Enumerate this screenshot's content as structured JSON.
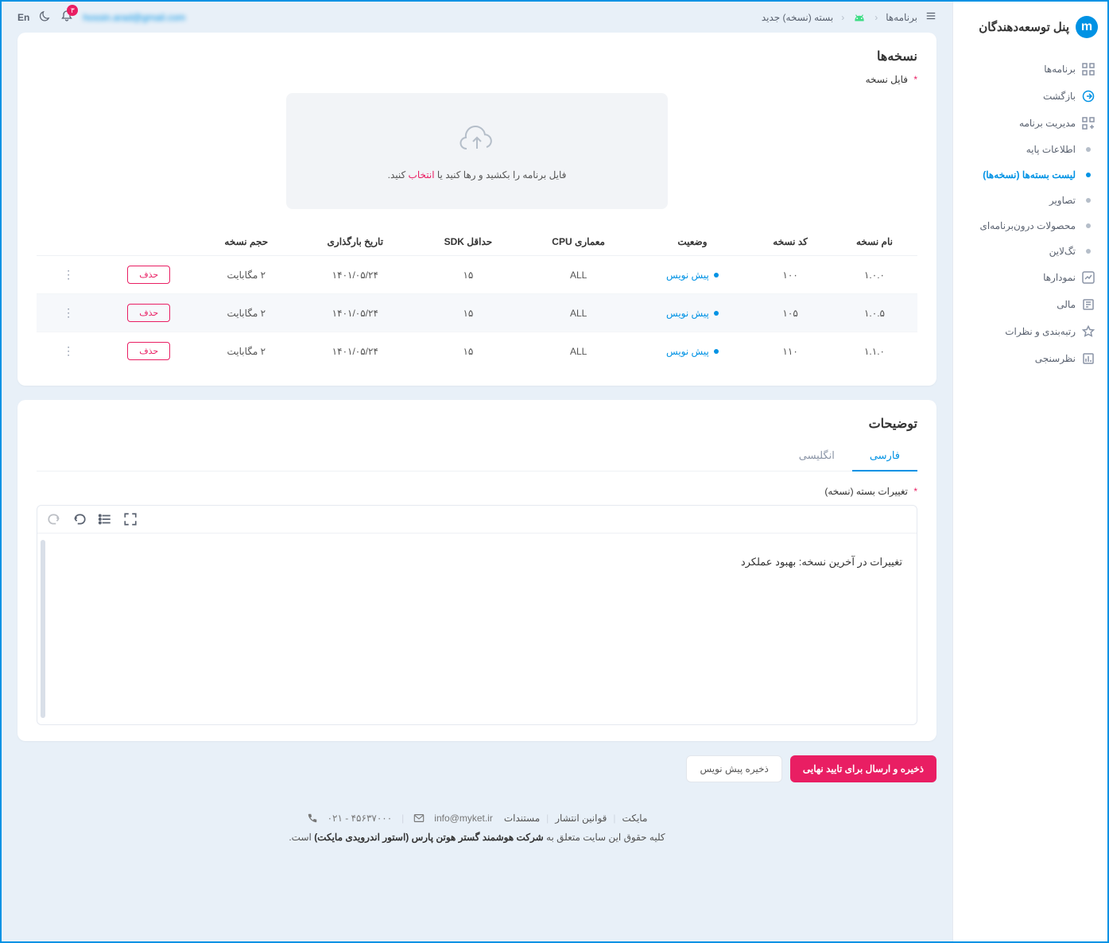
{
  "brand": {
    "title": "پنل توسعه‌دهندگان"
  },
  "nav": {
    "apps": "برنامه‌ها",
    "back": "بازگشت",
    "manage": "مدیریت برنامه",
    "basic": "اطلاعات پایه",
    "packages": "لیست بسته‌ها (نسخه‌ها)",
    "images": "تصاویر",
    "iap": "محصولات درون‌برنامه‌ای",
    "tagline": "تگ‌لاین",
    "charts": "نمودارها",
    "finance": "مالی",
    "rating": "رتبه‌بندی و نظرات",
    "survey": "نظرسنجی"
  },
  "breadcrumb": {
    "apps": "برنامه‌ها",
    "current": "بسته (نسخه) جدید"
  },
  "topbar": {
    "lang": "En",
    "user": "hossin.arad@gmail.com",
    "badge": "۳"
  },
  "versions": {
    "title": "نسخه‌ها",
    "file_label": "فایل نسخه",
    "dropzone_text": "فایل برنامه را بکشید و رها کنید یا ",
    "dropzone_link": "انتخاب",
    "dropzone_suffix": " کنید.",
    "headers": {
      "name": "نام نسخه",
      "code": "کد نسخه",
      "status": "وضعیت",
      "cpu": "معماری CPU",
      "sdk": "حداقل SDK",
      "upload_date": "تاریخ بارگذاری",
      "size": "حجم نسخه",
      "action": ""
    },
    "rows": [
      {
        "name": "۱.۰.۰",
        "code": "۱۰۰",
        "status": "پیش نویس",
        "cpu": "ALL",
        "sdk": "۱۵",
        "date": "۱۴۰۱/۰۵/۲۴",
        "size": "۲ مگابایت",
        "del": "حذف"
      },
      {
        "name": "۱.۰.۵",
        "code": "۱۰۵",
        "status": "پیش نویس",
        "cpu": "ALL",
        "sdk": "۱۵",
        "date": "۱۴۰۱/۰۵/۲۴",
        "size": "۲ مگابایت",
        "del": "حذف"
      },
      {
        "name": "۱.۱.۰",
        "code": "۱۱۰",
        "status": "پیش نویس",
        "cpu": "ALL",
        "sdk": "۱۵",
        "date": "۱۴۰۱/۰۵/۲۴",
        "size": "۲ مگابایت",
        "del": "حذف"
      }
    ]
  },
  "desc": {
    "title": "توضیحات",
    "tab_fa": "فارسی",
    "tab_en": "انگلیسی",
    "field_label": "تغییرات بسته (نسخه)",
    "body": "تغییرات در آخرین نسخه: بهبود عملکرد"
  },
  "actions": {
    "submit": "ذخیره و ارسال برای تایید نهایی",
    "draft": "ذخیره پیش نویس"
  },
  "footer": {
    "link1": "مایکت",
    "link2": "قوانین انتشار",
    "link3": "مستندات",
    "phone": "۰۲۱ - ۴۵۶۳۷۰۰۰",
    "email": "info@myket.ir",
    "copyright_pre": "کلیه حقوق این سایت متعلق به ",
    "copyright_b": "شرکت هوشمند گستر هوتن پارس (استور اندرویدی مایکت)",
    "copyright_suf": " است."
  }
}
